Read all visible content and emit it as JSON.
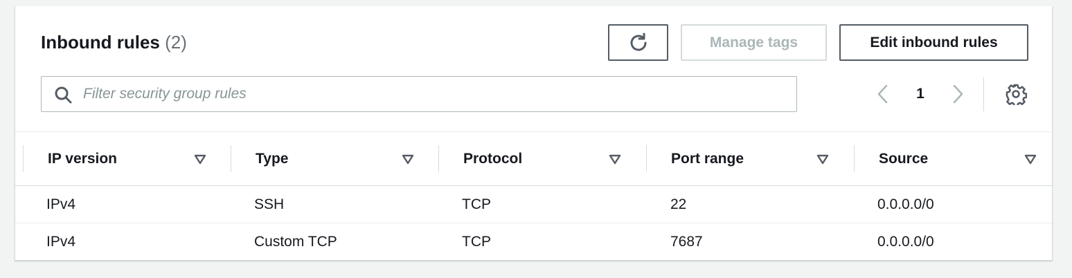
{
  "header": {
    "title": "Inbound rules",
    "count": "(2)"
  },
  "toolbar": {
    "refresh_icon": "refresh-icon",
    "manage_tags_label": "Manage tags",
    "edit_label": "Edit inbound rules"
  },
  "search": {
    "placeholder": "Filter security group rules",
    "value": ""
  },
  "pagination": {
    "current_page": "1",
    "prev_icon": "chevron-left-icon",
    "next_icon": "chevron-right-icon",
    "settings_icon": "gear-icon"
  },
  "table": {
    "columns": [
      {
        "label": "IP version"
      },
      {
        "label": "Type"
      },
      {
        "label": "Protocol"
      },
      {
        "label": "Port range"
      },
      {
        "label": "Source"
      }
    ],
    "rows": [
      {
        "ip_version": "IPv4",
        "type": "SSH",
        "protocol": "TCP",
        "port_range": "22",
        "source": "0.0.0.0/0"
      },
      {
        "ip_version": "IPv4",
        "type": "Custom TCP",
        "protocol": "TCP",
        "port_range": "7687",
        "source": "0.0.0.0/0"
      }
    ]
  },
  "colors": {
    "text": "#16191f",
    "muted": "#687078",
    "disabled": "#aab7b8",
    "border": "#545b64"
  }
}
